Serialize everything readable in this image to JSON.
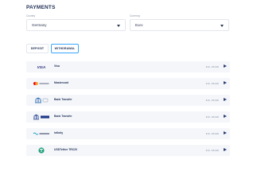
{
  "payments": {
    "title": "PAYMENTS",
    "country": {
      "label": "Country",
      "value": "Germany"
    },
    "currency": {
      "label": "Currency",
      "value": "Euro"
    },
    "tabs": [
      {
        "label": "DEPOSIT",
        "active": false
      },
      {
        "label": "WITHDRAWAL",
        "active": true
      }
    ],
    "methods": [
      {
        "name": "Visa",
        "range": "€10 - €5,000",
        "icon": "visa-logo"
      },
      {
        "name": "Mastercard",
        "range": "€10 - €5,000",
        "icon": "mastercard-logo"
      },
      {
        "name": "Bank Transfer",
        "range": "€10 - €5,000",
        "icon": "bank-transfer-logo"
      },
      {
        "name": "Bank Transfer",
        "range": "€10 - €5,000",
        "icon": "sepa-bank-logo"
      },
      {
        "name": "Infinity",
        "range": "€10 - €5,000",
        "icon": "infinity-logo"
      },
      {
        "name": "USDTether TRC20",
        "range": "€10 - €5,000",
        "icon": "tether-logo"
      }
    ]
  },
  "colors": {
    "accent": "#3aa7ff",
    "title": "#1e2d52",
    "row_bg": "#f4f6fa",
    "tether": "#26a17b",
    "visa": "#1a1f71"
  }
}
